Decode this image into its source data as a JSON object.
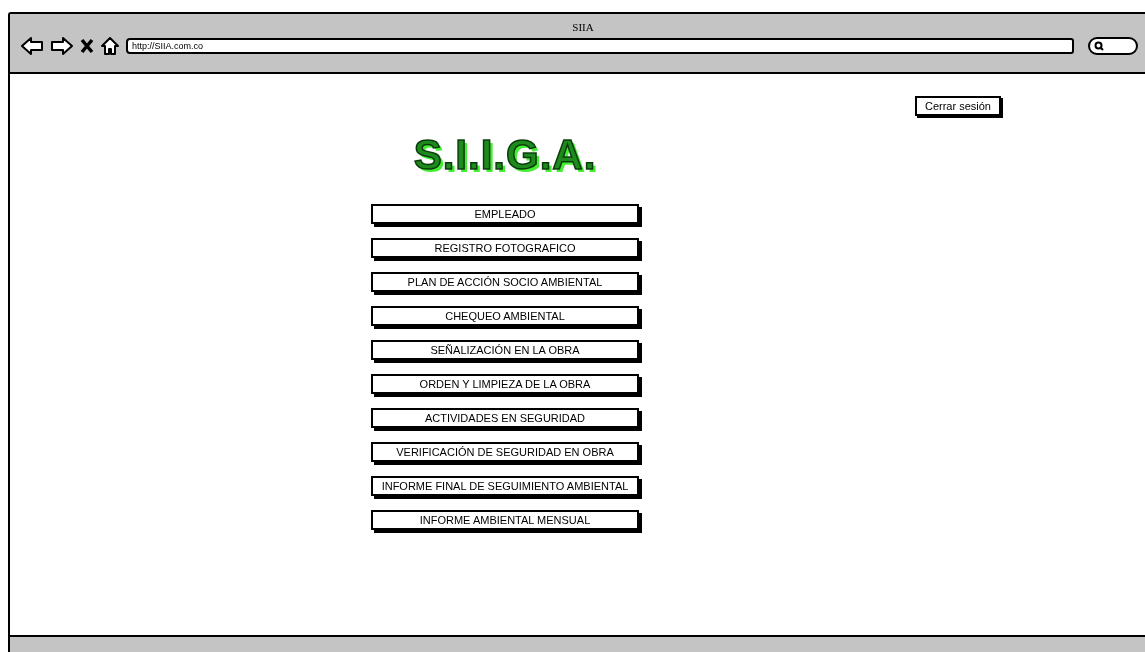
{
  "window": {
    "title": "SIIA"
  },
  "address_bar": {
    "value": "http://SIIA.com.co"
  },
  "logout_button": "Cerrar sesión",
  "logo": "S.I.I.G.A.",
  "menu": [
    "EMPLEADO",
    "REGISTRO FOTOGRAFICO",
    "PLAN DE ACCIÓN SOCIO AMBIENTAL",
    "CHEQUEO AMBIENTAL",
    "SEÑALIZACIÓN EN LA OBRA",
    "ORDEN Y LIMPIEZA DE LA OBRA",
    "ACTIVIDADES EN SEGURIDAD",
    "VERIFICACIÓN DE SEGURIDAD EN OBRA",
    "INFORME FINAL DE SEGUIMIENTO AMBIENTAL",
    "INFORME AMBIENTAL MENSUAL"
  ]
}
